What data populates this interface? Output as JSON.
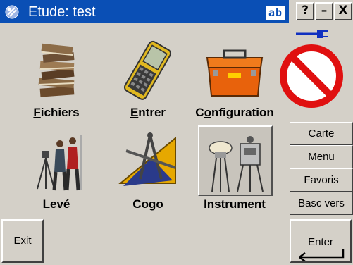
{
  "window": {
    "title": "Etude: test",
    "input_indicator": "ab",
    "help_label": "?",
    "minimize_label": "–",
    "close_label": "X"
  },
  "main": {
    "tiles": [
      {
        "label": "Fichiers",
        "underline": "F",
        "rest": "ichiers",
        "icon": "stacked-books-icon"
      },
      {
        "label": "Entrer",
        "underline": "E",
        "rest": "ntrer",
        "icon": "handheld-controller-icon"
      },
      {
        "label": "Configuration",
        "underline": "o",
        "prefix": "C",
        "rest": "nfiguration",
        "icon": "toolbox-icon"
      },
      {
        "label": "Levé",
        "prefix": "",
        "underline": "L",
        "rest": "evé",
        "icon": "surveyors-icon"
      },
      {
        "label": "Cogo",
        "underline": "C",
        "rest": "ogo",
        "icon": "compass-triangle-icon"
      },
      {
        "label": "Instrument",
        "underline": "I",
        "rest": "nstrument",
        "icon": "gps-total-station-icon"
      }
    ]
  },
  "side": {
    "connection_icon": "plug-connection-icon",
    "status_icon": "no-connection-prohibited-icon",
    "buttons": [
      "Carte",
      "Menu",
      "Favoris",
      "Basc vers"
    ]
  },
  "bottom": {
    "exit_label": "Exit",
    "enter_label": "Enter"
  },
  "colors": {
    "title_bar": "#0a4fb5",
    "background": "#d4d0c8",
    "prohibit_red": "#e01010"
  }
}
